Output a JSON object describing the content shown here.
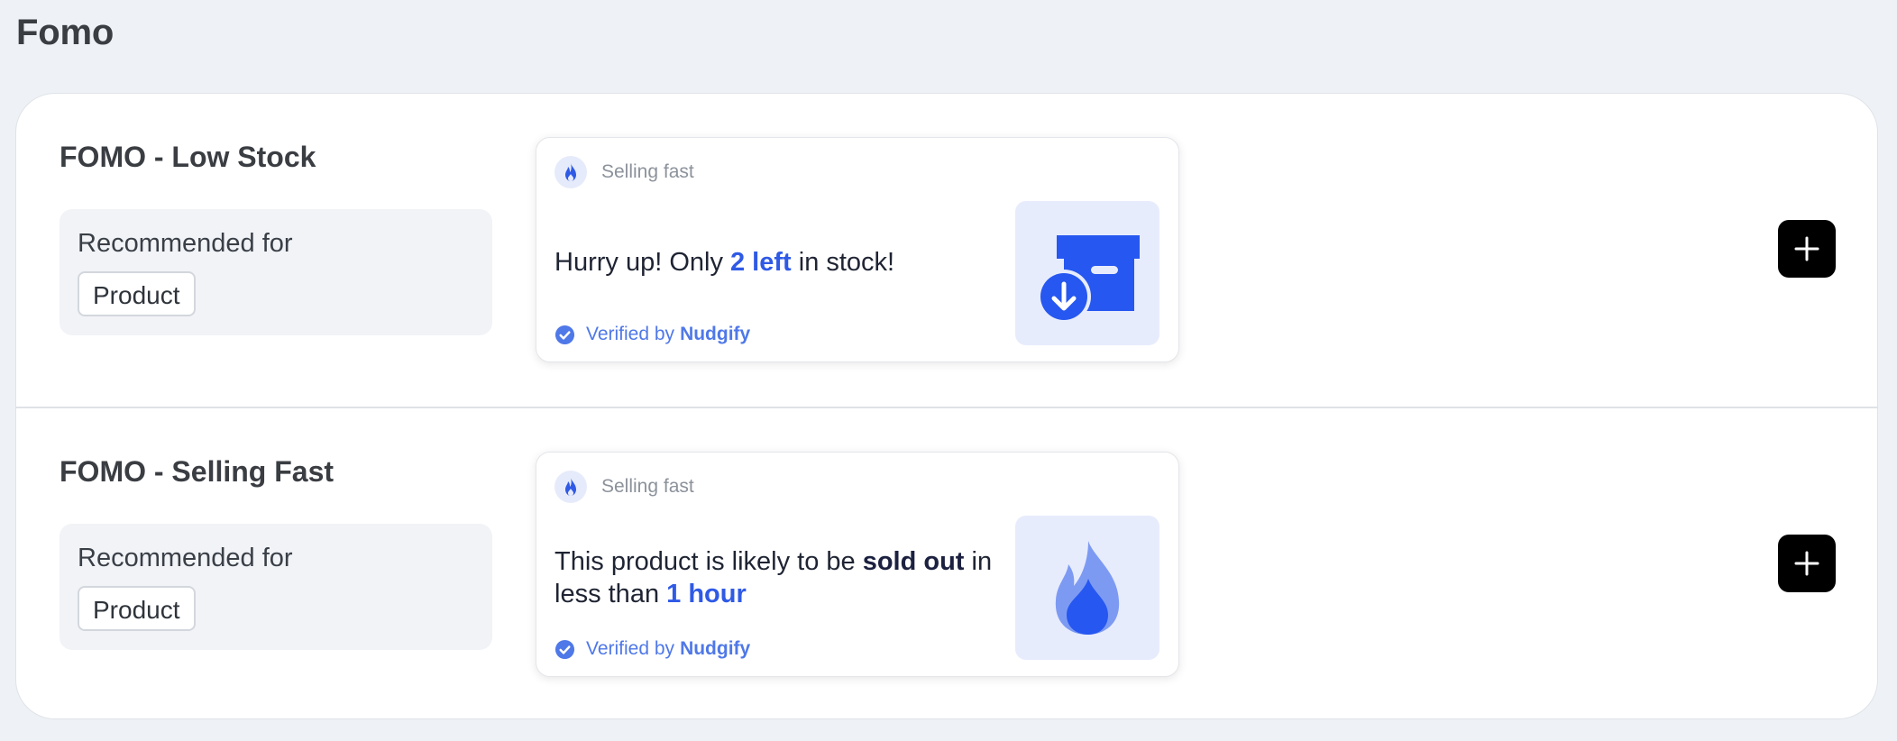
{
  "page": {
    "title": "Fomo"
  },
  "colors": {
    "accent": "#2f5ae6",
    "verified": "#4f78e8",
    "card_image_bg": "#e7ecfd"
  },
  "templates": [
    {
      "title": "FOMO - Low Stock",
      "recommended_label": "Recommended for",
      "recommended_tag": "Product",
      "preview": {
        "header_icon": "fire-icon",
        "header_label": "Selling fast",
        "message_pre": "Hurry up! Only ",
        "message_highlight": "2 left",
        "message_post": " in stock!",
        "verified_prefix": "Verified by",
        "verified_brand": "Nudgify",
        "image_icon": "box-download-icon"
      },
      "add_icon": "plus-icon"
    },
    {
      "title": "FOMO - Selling Fast",
      "recommended_label": "Recommended for",
      "recommended_tag": "Product",
      "preview": {
        "header_icon": "fire-icon",
        "header_label": "Selling fast",
        "message_pre": "This product is likely to be ",
        "message_strong": "sold out",
        "message_mid": " in less than ",
        "message_highlight": "1 hour",
        "verified_prefix": "Verified by",
        "verified_brand": "Nudgify",
        "image_icon": "flame-icon"
      },
      "add_icon": "plus-icon"
    }
  ]
}
